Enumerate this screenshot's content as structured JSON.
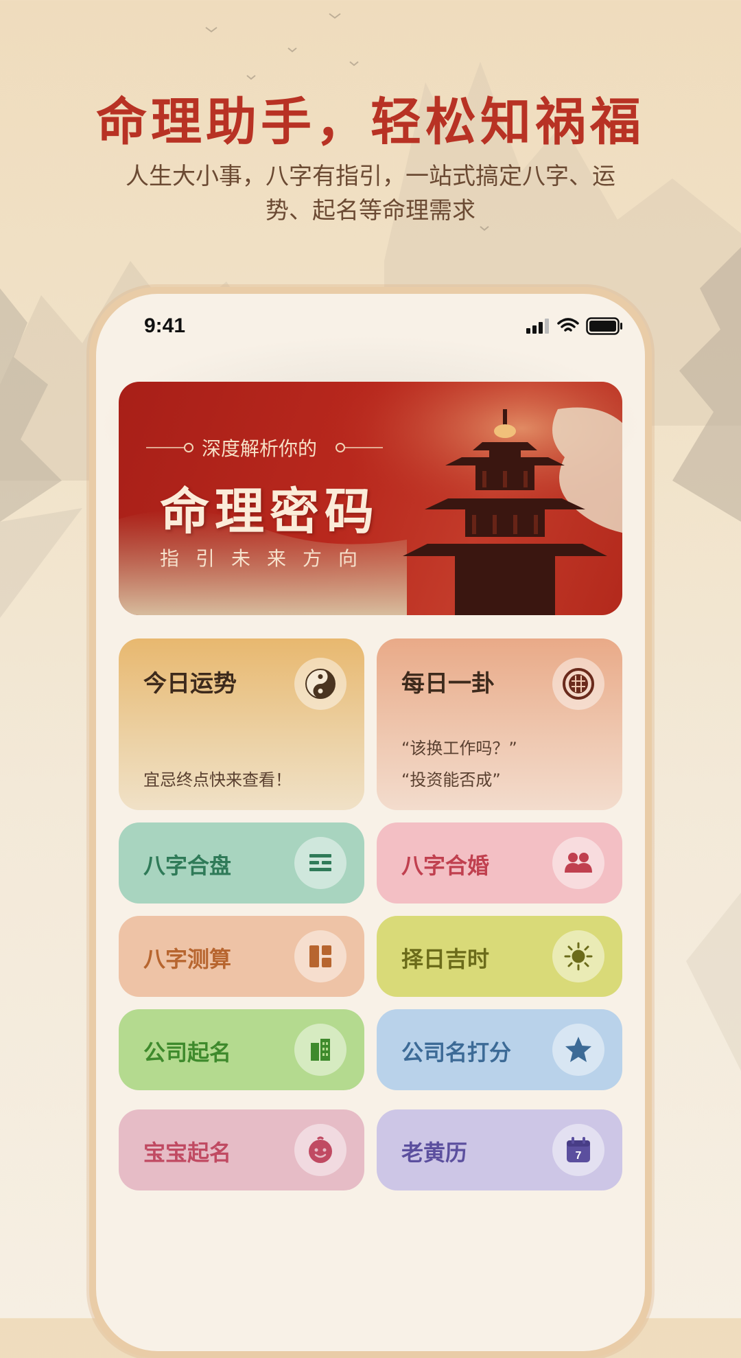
{
  "hero": {
    "title": "命理助手，轻松知祸福",
    "subtitle": "人生大小事，八字有指引，一站式搞定八字、运势、起名等命理需求"
  },
  "status_bar": {
    "time": "9:41"
  },
  "banner": {
    "kicker": "深度解析你的",
    "title": "命理密码",
    "subtitle": "指引未来方向"
  },
  "feature_cards": {
    "daily_fortune": {
      "label": "今日运势",
      "caption": "宜忌终点快来查看！",
      "icon": "yin-yang-icon"
    },
    "daily_divination": {
      "label": "每日一卦",
      "caption_1": "“该换工作吗？”",
      "caption_2": "“投资能否成”",
      "icon": "bagua-icon"
    }
  },
  "grid_items": [
    {
      "label": "八字合盘",
      "icon": "hexagram-icon",
      "color": "#a8d4bf",
      "text_color": "#2f7a58"
    },
    {
      "label": "八字合婚",
      "icon": "couple-icon",
      "color": "#f3bfc4",
      "text_color": "#c0404f"
    },
    {
      "label": "八字测算",
      "icon": "layout-icon",
      "color": "#eec3a6",
      "text_color": "#b7652f"
    },
    {
      "label": "择日吉时",
      "icon": "sun-icon",
      "color": "#d9da78",
      "text_color": "#6b6b1a"
    },
    {
      "label": "公司起名",
      "icon": "building-icon",
      "color": "#b4da8f",
      "text_color": "#3e8a2c"
    },
    {
      "label": "公司名打分",
      "icon": "star-icon",
      "color": "#b9d2ea",
      "text_color": "#3c6a96"
    },
    {
      "label": "宝宝起名",
      "icon": "baby-icon",
      "color": "#e6bcc6",
      "text_color": "#c04a62"
    },
    {
      "label": "老黄历",
      "icon": "calendar-icon",
      "color": "#cdc6e6",
      "text_color": "#5b4f9e",
      "badge": "7"
    }
  ]
}
